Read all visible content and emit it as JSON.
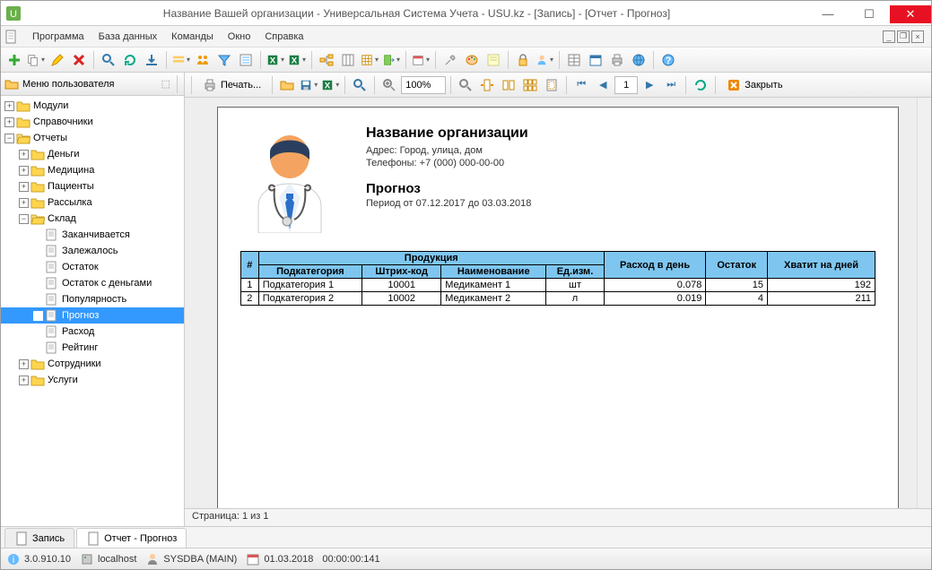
{
  "window": {
    "title": "Название Вашей организации - Универсальная Система Учета - USU.kz - [Запись] - [Отчет - Прогноз]"
  },
  "menu": {
    "items": [
      "Программа",
      "База данных",
      "Команды",
      "Окно",
      "Справка"
    ]
  },
  "sidebar": {
    "title": "Меню пользователя",
    "nodes": [
      {
        "label": "Модули",
        "lvl": 1,
        "exp": "+",
        "folder": "closed"
      },
      {
        "label": "Справочники",
        "lvl": 1,
        "exp": "+",
        "folder": "closed"
      },
      {
        "label": "Отчеты",
        "lvl": 1,
        "exp": "−",
        "folder": "open"
      },
      {
        "label": "Деньги",
        "lvl": 2,
        "exp": "+",
        "folder": "closed"
      },
      {
        "label": "Медицина",
        "lvl": 2,
        "exp": "+",
        "folder": "closed"
      },
      {
        "label": "Пациенты",
        "lvl": 2,
        "exp": "+",
        "folder": "closed"
      },
      {
        "label": "Рассылка",
        "lvl": 2,
        "exp": "+",
        "folder": "closed"
      },
      {
        "label": "Склад",
        "lvl": 2,
        "exp": "−",
        "folder": "open"
      },
      {
        "label": "Заканчивается",
        "lvl": 3,
        "exp": "",
        "folder": "doc"
      },
      {
        "label": "Залежалось",
        "lvl": 3,
        "exp": "",
        "folder": "doc"
      },
      {
        "label": "Остаток",
        "lvl": 3,
        "exp": "",
        "folder": "doc"
      },
      {
        "label": "Остаток с деньгами",
        "lvl": 3,
        "exp": "",
        "folder": "doc"
      },
      {
        "label": "Популярность",
        "lvl": 3,
        "exp": "",
        "folder": "doc"
      },
      {
        "label": "Прогноз",
        "lvl": 3,
        "exp": "",
        "folder": "doc",
        "selected": true
      },
      {
        "label": "Расход",
        "lvl": 3,
        "exp": "",
        "folder": "doc"
      },
      {
        "label": "Рейтинг",
        "lvl": 3,
        "exp": "",
        "folder": "doc"
      },
      {
        "label": "Сотрудники",
        "lvl": 2,
        "exp": "+",
        "folder": "closed"
      },
      {
        "label": "Услуги",
        "lvl": 2,
        "exp": "+",
        "folder": "closed"
      }
    ]
  },
  "report_toolbar": {
    "print": "Печать...",
    "zoom": "100%",
    "page": "1",
    "close": "Закрыть"
  },
  "report": {
    "org_name": "Название организации",
    "address": "Адрес: Город, улица, дом",
    "phones": "Телефоны: +7 (000) 000-00-00",
    "report_name": "Прогноз",
    "period": "Период от 07.12.2017 до 03.03.2018",
    "headers": {
      "num": "#",
      "product": "Продукция",
      "subcategory": "Подкатегория",
      "barcode": "Штрих-код",
      "name": "Наименование",
      "unit": "Ед.изм.",
      "per_day": "Расход в день",
      "stock": "Остаток",
      "lasts": "Хватит на дней"
    },
    "rows": [
      {
        "n": "1",
        "cat": "Подкатегория 1",
        "code": "10001",
        "name": "Медикамент 1",
        "unit": "шт",
        "perday": "0.078",
        "stock": "15",
        "days": "192"
      },
      {
        "n": "2",
        "cat": "Подкатегория 2",
        "code": "10002",
        "name": "Медикамент 2",
        "unit": "л",
        "perday": "0.019",
        "stock": "4",
        "days": "211"
      }
    ]
  },
  "page_status": "Страница: 1 из 1",
  "tabs": {
    "record": "Запись",
    "report": "Отчет - Прогноз"
  },
  "statusbar": {
    "version": "3.0.910.10",
    "host": "localhost",
    "user": "SYSDBA (MAIN)",
    "date": "01.03.2018",
    "time": "00:00:00:141"
  },
  "icons": {
    "add": "#3a3",
    "copy": "#888",
    "edit": "#c80",
    "del": "#d22",
    "search": "#37a",
    "refresh": "#0a8",
    "nav_first": "⏮",
    "nav_prev": "◀",
    "nav_next": "▶",
    "nav_last": "⏭"
  },
  "chart_data": {
    "type": "table",
    "title": "Прогноз",
    "subtitle": "Период от 07.12.2017 до 03.03.2018",
    "columns": [
      "#",
      "Подкатегория",
      "Штрих-код",
      "Наименование",
      "Ед.изм.",
      "Расход в день",
      "Остаток",
      "Хватит на дней"
    ],
    "rows": [
      [
        1,
        "Подкатегория 1",
        10001,
        "Медикамент 1",
        "шт",
        0.078,
        15,
        192
      ],
      [
        2,
        "Подкатегория 2",
        10002,
        "Медикамент 2",
        "л",
        0.019,
        4,
        211
      ]
    ]
  }
}
